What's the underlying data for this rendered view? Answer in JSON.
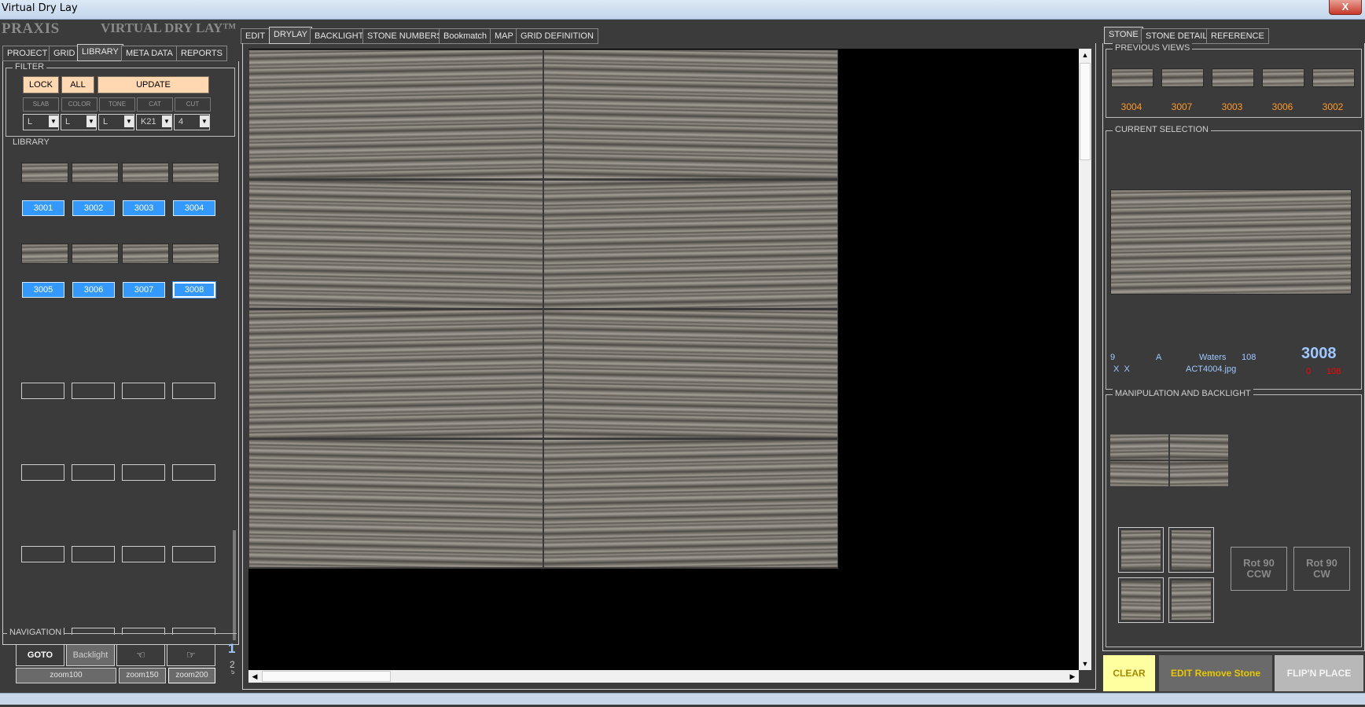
{
  "window": {
    "title": "Virtual Dry Lay",
    "close_glyph": "X"
  },
  "brand": {
    "logo": "PRAXIS",
    "product": "VIRTUAL DRY LAY™"
  },
  "left_tabs": [
    {
      "label": "PROJECT",
      "active": false
    },
    {
      "label": "GRID",
      "active": false
    },
    {
      "label": "LIBRARY",
      "active": true
    },
    {
      "label": "META DATA",
      "active": false
    },
    {
      "label": "REPORTS",
      "active": false
    }
  ],
  "filter": {
    "title": "FILTER",
    "lock": "LOCK",
    "all": "ALL",
    "update": "UPDATE",
    "categories": [
      "SLAB",
      "COLOR",
      "TONE",
      "CAT",
      "CUT"
    ],
    "dropdowns": [
      "L",
      "L",
      "L",
      "K21",
      "4"
    ]
  },
  "library": {
    "title": "LIBRARY",
    "row1": [
      "3001",
      "3002",
      "3003",
      "3004"
    ],
    "row2": [
      "3005",
      "3006",
      "3007",
      "3008"
    ],
    "selected": "3008"
  },
  "navigation": {
    "title": "NAVIGATION",
    "goto": "GOTO",
    "backlight": "Backlight",
    "zoom": [
      "zoom100",
      "zoom150",
      "zoom200"
    ],
    "pages": [
      "1",
      "2",
      "5"
    ]
  },
  "center_tabs": [
    {
      "label": "EDIT",
      "active": false
    },
    {
      "label": "DRYLAY",
      "active": true
    },
    {
      "label": "BACKLIGHT",
      "active": false
    },
    {
      "label": "STONE NUMBERS",
      "active": false
    },
    {
      "label": "Bookmatch",
      "active": false
    },
    {
      "label": "MAP",
      "active": false
    },
    {
      "label": "GRID DEFINITION",
      "active": false
    }
  ],
  "right_tabs": [
    {
      "label": "STONE",
      "active": true
    },
    {
      "label": "STONE DETAIL",
      "active": false
    },
    {
      "label": "REFERENCE",
      "active": false
    }
  ],
  "previous_views": {
    "title": "PREVIOUS VIEWS",
    "items": [
      "3004",
      "3007",
      "3003",
      "3006",
      "3002"
    ]
  },
  "current_selection": {
    "title": "CURRENT SELECTION",
    "field1": "9",
    "field2": "A",
    "field3": "Waters",
    "field4": "108",
    "flags": "X  X",
    "filename": "ACT4004.jpg",
    "stone_number": "3008",
    "red1": "0",
    "red2": "108"
  },
  "manipulation": {
    "title": "MANIPULATION AND BACKLIGHT",
    "rot_ccw": [
      "Rot 90",
      "CCW"
    ],
    "rot_cw": [
      "Rot 90",
      "CW"
    ]
  },
  "bottom_buttons": {
    "clear": "CLEAR",
    "edit_remove": "EDIT Remove Stone",
    "flip": "FLIP'N PLACE"
  },
  "colors": {
    "selected_blue": "#3399ff",
    "orange_number": "#ff9a2a",
    "stone_number": "#9ec8ff",
    "clear_yellow": "#ffffa0"
  }
}
